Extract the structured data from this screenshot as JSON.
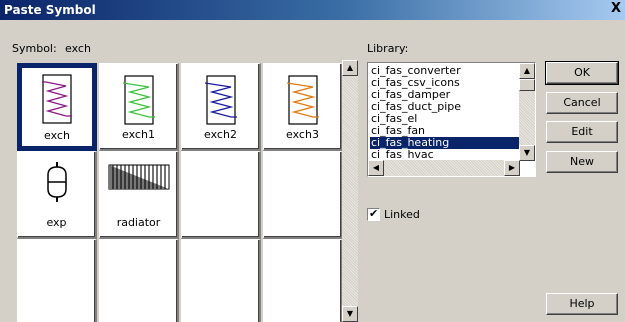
{
  "window": {
    "title": "Paste Symbol",
    "close_glyph": "X"
  },
  "symbol": {
    "label": "Symbol:",
    "value": "exch"
  },
  "library": {
    "label": "Library:",
    "items": [
      "ci_fas_converter",
      "ci_fas_csv_icons",
      "ci_fas_damper",
      "ci_fas_duct_pipe",
      "ci_fas_el",
      "ci_fas_fan",
      "ci_fas_heating",
      "ci_fas_hvac"
    ],
    "selected": "ci_fas_heating"
  },
  "symbols": [
    {
      "name": "exch",
      "icon": "heat-exchanger-icon",
      "color": "#8b1a8b",
      "selected": true
    },
    {
      "name": "exch1",
      "icon": "heat-exchanger-icon",
      "color": "#3cc23c",
      "selected": false
    },
    {
      "name": "exch2",
      "icon": "heat-exchanger-icon",
      "color": "#1a1aa0",
      "selected": false
    },
    {
      "name": "exch3",
      "icon": "heat-exchanger-icon",
      "color": "#e07a10",
      "selected": false
    },
    {
      "name": "exp",
      "icon": "expansion-tank-icon",
      "selected": false
    },
    {
      "name": "radiator",
      "icon": "radiator-icon",
      "selected": false
    },
    {
      "name": "",
      "selected": false
    },
    {
      "name": "",
      "selected": false
    },
    {
      "name": "",
      "selected": false
    },
    {
      "name": "",
      "selected": false
    },
    {
      "name": "",
      "selected": false
    },
    {
      "name": "",
      "selected": false
    }
  ],
  "linked": {
    "label": "Linked",
    "checked": true,
    "check_glyph": "✔"
  },
  "buttons": {
    "ok": "OK",
    "cancel": "Cancel",
    "edit": "Edit",
    "new": "New",
    "help": "Help"
  },
  "colors": {
    "selection": "#0a246a",
    "face": "#d4d0c8"
  }
}
